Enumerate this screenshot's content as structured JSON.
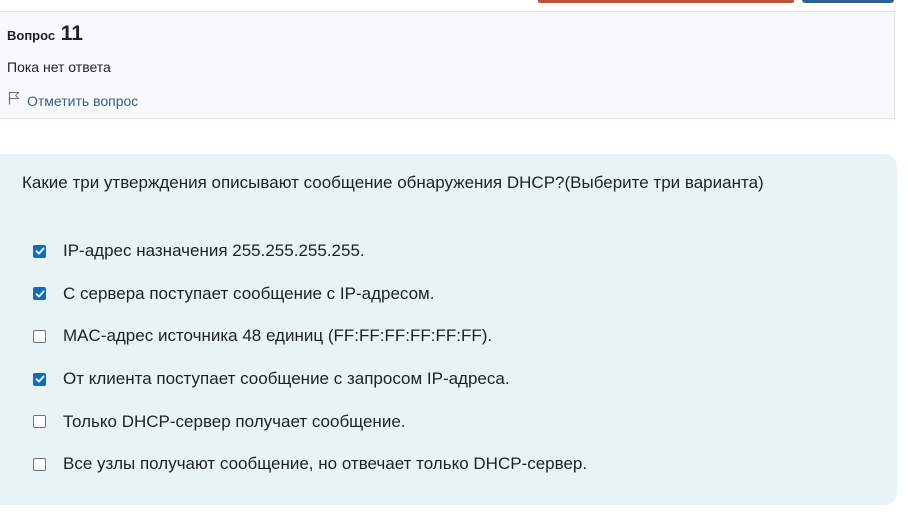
{
  "colors": {
    "accent": "#0f6cbf",
    "link": "#3b5b8c",
    "info_bg": "#f8f9fa",
    "formulation_bg": "#e7f3f5"
  },
  "question_info": {
    "label": "Вопрос",
    "number": "11",
    "state": "Пока нет ответа",
    "flag_icon": "flag-icon",
    "flag_label": "Отметить вопрос"
  },
  "question": {
    "text": "Какие три утверждения описывают сообщение обнаружения DHCP?(Выберите три варианта)",
    "answers": [
      {
        "label": "IP-адрес назначения 255.255.255.255.",
        "checked": true
      },
      {
        "label": "С сервера поступает сообщение с IP-адресом.",
        "checked": true
      },
      {
        "label": "MAC-адрес источника 48 единиц (FF:FF:FF:FF:FF:FF).",
        "checked": false
      },
      {
        "label": "От клиента поступает сообщение с запросом IP-адреса.",
        "checked": true
      },
      {
        "label": "Только DHCP-сервер получает сообщение.",
        "checked": false
      },
      {
        "label": "Все узлы получают сообщение, но отвечает только DHCP-сервер.",
        "checked": false
      }
    ]
  }
}
